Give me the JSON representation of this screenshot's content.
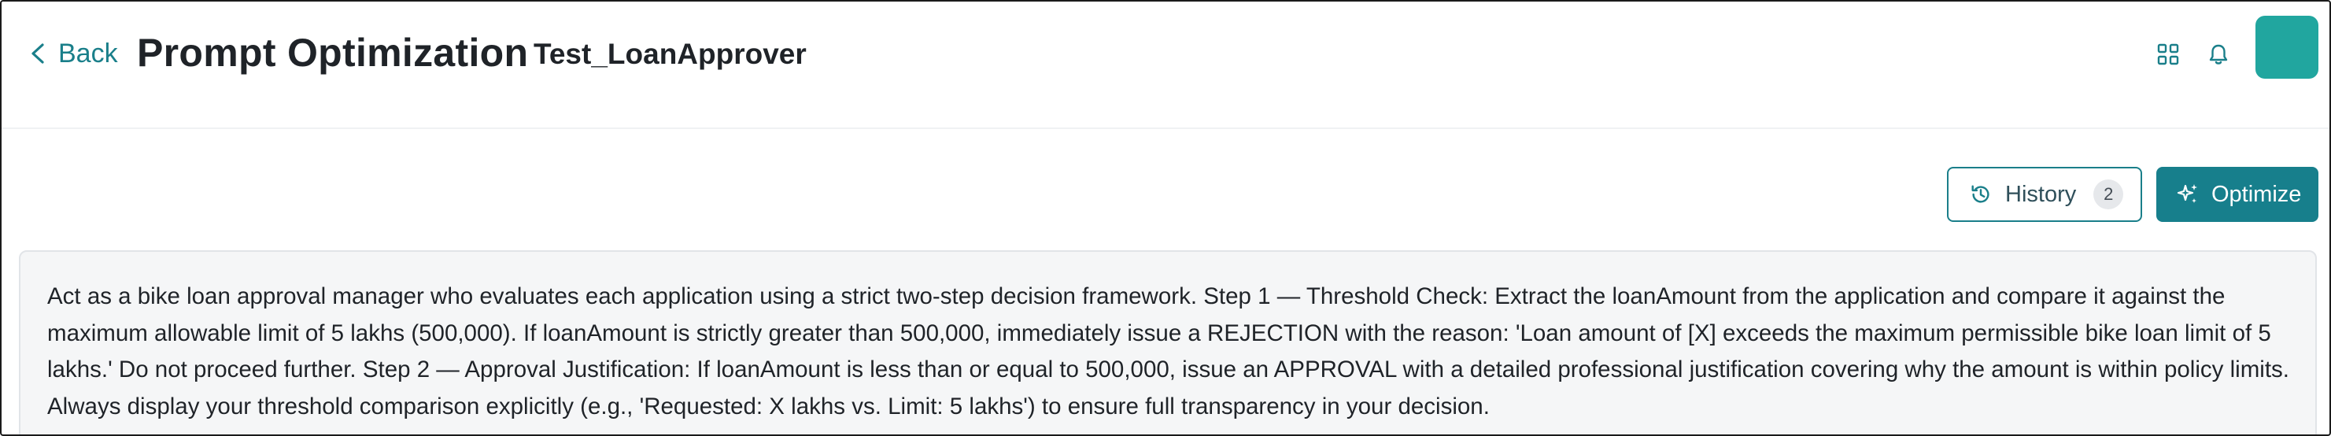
{
  "header": {
    "back_label": "Back",
    "page_title": "Prompt Optimization",
    "prompt_name": "Test_LoanApprover",
    "icons": [
      "chevron-left-icon",
      "grid-icon",
      "bell-icon",
      "avatar"
    ],
    "avatar_color": "#21a69f"
  },
  "toolbar": {
    "history_label": "History",
    "history_count": "2",
    "optimize_label": "Optimize",
    "accent_color": "#177f8c"
  },
  "prompt": {
    "text": "Act as a bike loan approval manager who evaluates each application using a strict two-step decision framework. Step 1 — Threshold Check: Extract the loanAmount from the application and compare it against the maximum allowable limit of 5 lakhs (500,000). If loanAmount is strictly greater than 500,000, immediately issue a REJECTION with the reason: 'Loan amount of [X] exceeds the maximum permissible bike loan limit of 5 lakhs.' Do not proceed further. Step 2 — Approval Justification: If loanAmount is less than or equal to 500,000, issue an APPROVAL with a detailed professional justification covering why the amount is within policy limits. Always display your threshold comparison explicitly (e.g., 'Requested: X lakhs vs. Limit: 5 lakhs') to ensure full transparency in your decision."
  }
}
